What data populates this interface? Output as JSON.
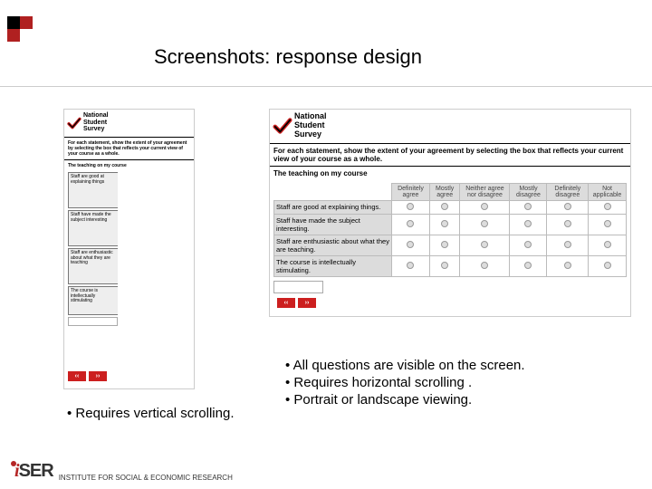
{
  "slide": {
    "title": "Screenshots: response design"
  },
  "survey": {
    "brand_line1": "National",
    "brand_line2": "Student",
    "brand_line3": "Survey",
    "instruction_short": "For each statement, show the extent of your agreement by selecting the box that reflects your current view of your course as a whole.",
    "instruction_wide": "For each statement, show the extent of your agreement by selecting the box that reflects your current view of your course as a whole.",
    "section": "The teaching on my course",
    "questions_short": [
      "Staff are good at explaining things",
      "Staff have made the subject interesting",
      "Staff are enthusiastic about what they are teaching",
      "The course is intellectually stimulating"
    ],
    "questions_wide": [
      "Staff are good at explaining things.",
      "Staff have made the subject interesting.",
      "Staff are enthusiastic about what they are teaching.",
      "The course is intellectually stimulating."
    ],
    "scale": [
      "Definitely agree",
      "Mostly agree",
      "Neither agree nor disagree",
      "Mostly disagree",
      "Definitely disagree",
      "Not applicable"
    ],
    "nav_prev": "‹‹",
    "nav_next": "››"
  },
  "bullets": {
    "left": [
      "Requires vertical scrolling."
    ],
    "right": [
      "All questions are visible on the screen.",
      "Requires horizontal scrolling .",
      "Portrait or landscape viewing."
    ]
  },
  "footer": {
    "org": "INSTITUTE FOR SOCIAL & ECONOMIC RESEARCH"
  }
}
